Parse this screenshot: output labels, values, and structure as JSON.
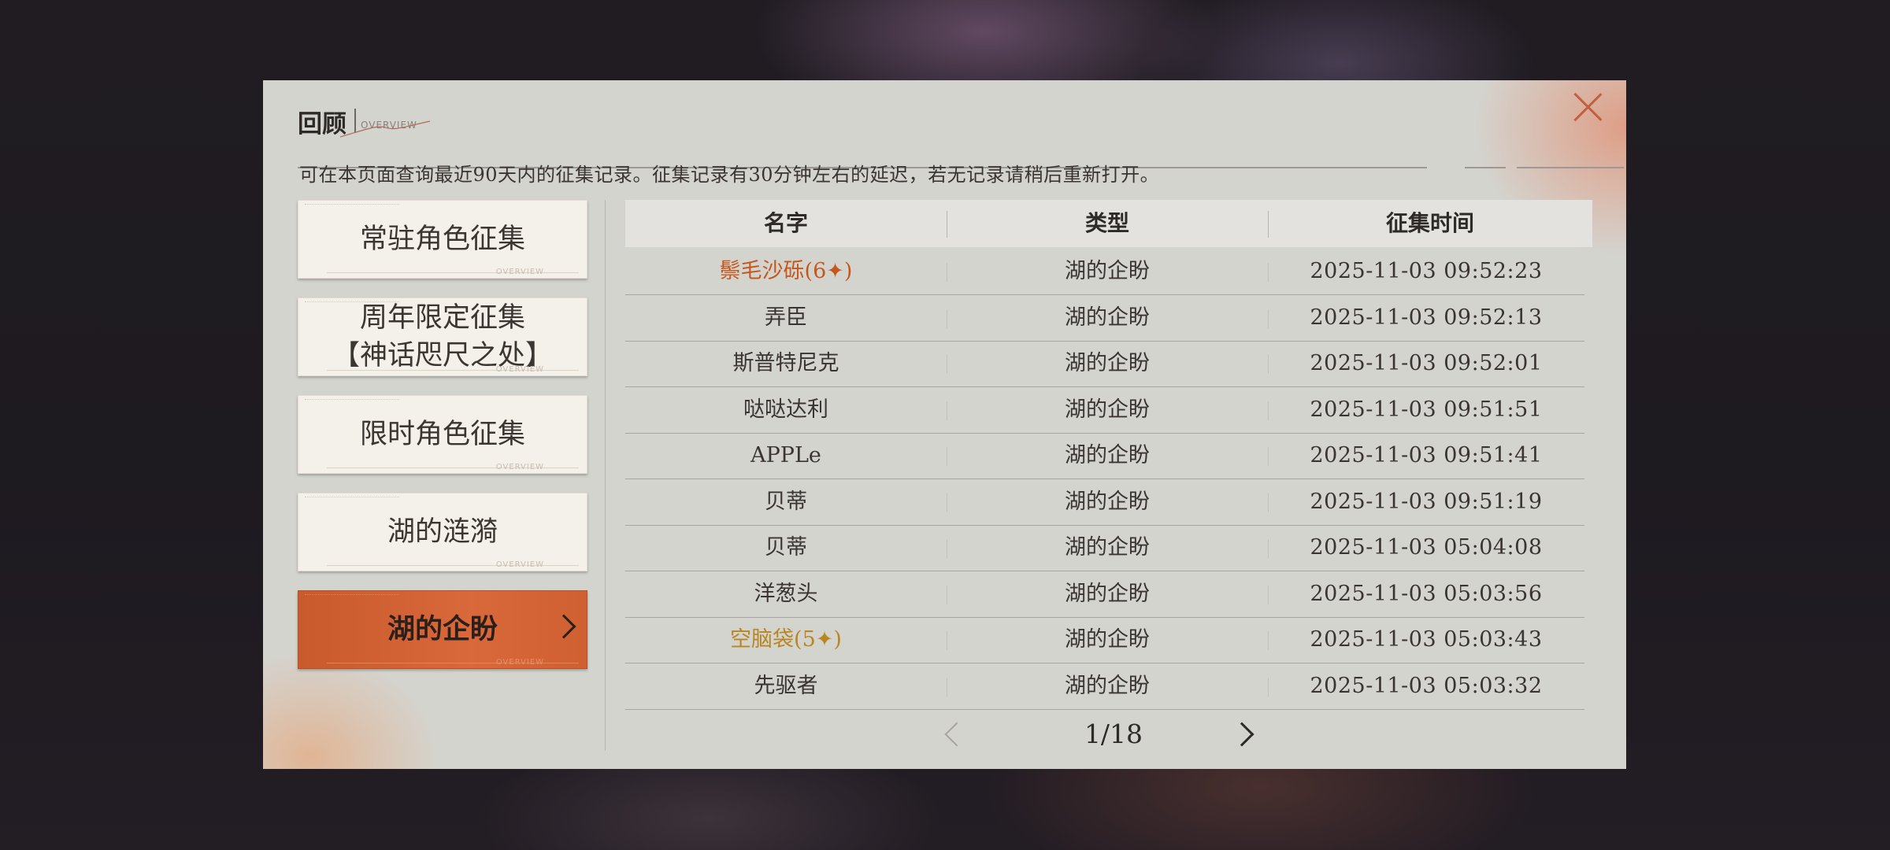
{
  "header": {
    "title": "回顾",
    "subtitle": "OVERVIEW",
    "description": "可在本页面查询最近90天内的征集记录。征集记录有30分钟左右的延迟，若无记录请稍后重新打开。"
  },
  "sidebar": {
    "items": [
      {
        "label": "常驻角色征集",
        "active": false
      },
      {
        "label": "周年限定征集\n【神话咫尺之处】",
        "active": false
      },
      {
        "label": "限时角色征集",
        "active": false
      },
      {
        "label": "湖的涟漪",
        "active": false
      },
      {
        "label": "湖的企盼",
        "active": true
      }
    ],
    "deco_label": "OVERVIEW"
  },
  "table": {
    "columns": [
      "名字",
      "类型",
      "征集时间"
    ],
    "rows": [
      {
        "name": "鬃毛沙砾(6✦)",
        "type": "湖的企盼",
        "time": "2025-11-03 09:52:23",
        "rarity": "6"
      },
      {
        "name": "弄臣",
        "type": "湖的企盼",
        "time": "2025-11-03 09:52:13",
        "rarity": ""
      },
      {
        "name": "斯普特尼克",
        "type": "湖的企盼",
        "time": "2025-11-03 09:52:01",
        "rarity": ""
      },
      {
        "name": "哒哒达利",
        "type": "湖的企盼",
        "time": "2025-11-03 09:51:51",
        "rarity": ""
      },
      {
        "name": "APPLe",
        "type": "湖的企盼",
        "time": "2025-11-03 09:51:41",
        "rarity": ""
      },
      {
        "name": "贝蒂",
        "type": "湖的企盼",
        "time": "2025-11-03 09:51:19",
        "rarity": ""
      },
      {
        "name": "贝蒂",
        "type": "湖的企盼",
        "time": "2025-11-03 05:04:08",
        "rarity": ""
      },
      {
        "name": "洋葱头",
        "type": "湖的企盼",
        "time": "2025-11-03 05:03:56",
        "rarity": ""
      },
      {
        "name": "空脑袋(5✦)",
        "type": "湖的企盼",
        "time": "2025-11-03 05:03:43",
        "rarity": "5"
      },
      {
        "name": "先驱者",
        "type": "湖的企盼",
        "time": "2025-11-03 05:03:32",
        "rarity": ""
      }
    ]
  },
  "pagination": {
    "current": "1/18"
  },
  "colors": {
    "accent": "#d9683a",
    "six_star": "#c4581f",
    "five_star": "#b88622",
    "panel_bg": "#d4d4cf"
  },
  "icons": {
    "close": "close-icon",
    "prev": "chevron-left-icon",
    "next": "chevron-right-icon"
  }
}
